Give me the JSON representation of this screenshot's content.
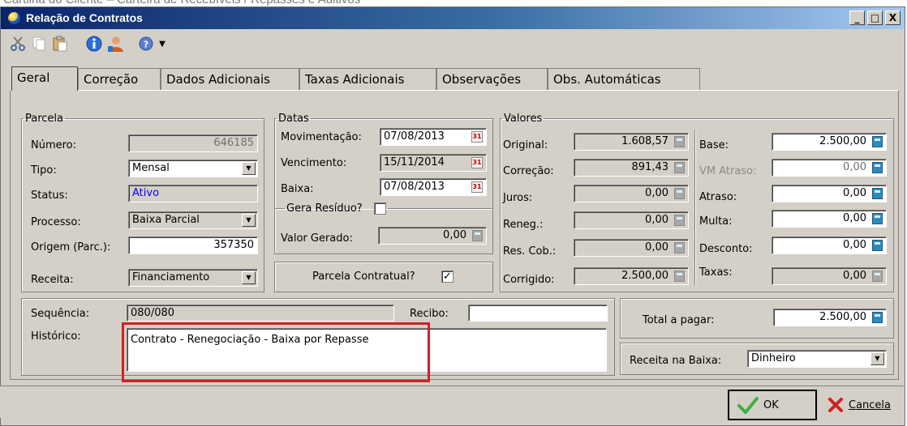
{
  "caption": "Cartilha do Cliente – Carteira de Recebíveis / Repasses e Aditivos",
  "window": {
    "title": "Relação de Contratos",
    "buttons": [
      "_",
      "□",
      "X"
    ]
  },
  "toolbar": {
    "icons": [
      "scissors-icon",
      "copy-icon",
      "paste-icon",
      "info-icon",
      "user-icon",
      "help-icon",
      "dropdown-arrow-icon"
    ]
  },
  "tabs": [
    "Geral",
    "Correção",
    "Dados Adicionais",
    "Taxas Adicionais",
    "Observações",
    "Obs. Automáticas"
  ],
  "parcela": {
    "legend": "Parcela",
    "numero_label": "Número:",
    "numero": "646185",
    "tipo_label": "Tipo:",
    "tipo": "Mensal",
    "status_label": "Status:",
    "status": "Ativo",
    "processo_label": "Processo:",
    "processo": "Baixa Parcial",
    "origem_label": "Origem (Parc.):",
    "origem": "357350",
    "receita_label": "Receita:",
    "receita": "Financiamento"
  },
  "datas": {
    "legend": "Datas",
    "movimentacao_label": "Movimentação:",
    "movimentacao": "07/08/2013",
    "vencimento_label": "Vencimento:",
    "vencimento": "15/11/2014",
    "baixa_label": "Baixa:",
    "baixa": "07/08/2013",
    "gera_residuo_label": "Gera Resíduo?",
    "gera_residuo": false,
    "valor_gerado_label": "Valor Gerado:",
    "valor_gerado": "0,00",
    "parcela_contratual_label": "Parcela Contratual?",
    "parcela_contratual": true,
    "cal_glyph": "31"
  },
  "valores": {
    "legend": "Valores",
    "original_label": "Original:",
    "original": "1.608,57",
    "correcao_label": "Correção:",
    "correcao": "891,43",
    "juros_label": "Juros:",
    "juros": "0,00",
    "reneg_label": "Reneg.:",
    "reneg": "0,00",
    "res_cob_label": "Res. Cob.:",
    "res_cob": "0,00",
    "corrigido_label": "Corrigido:",
    "corrigido": "2.500,00",
    "base_label": "Base:",
    "base": "2.500,00",
    "vm_atraso_label": "VM Atraso:",
    "vm_atraso": "0,00",
    "atraso_label": "Atraso:",
    "atraso": "0,00",
    "multa_label": "Multa:",
    "multa": "0,00",
    "desconto_label": "Desconto:",
    "desconto": "0,00",
    "taxas_label": "Taxas:",
    "taxas": "0,00"
  },
  "bottom": {
    "sequencia_label": "Sequência:",
    "sequencia": "080/080",
    "recibo_label": "Recibo:",
    "recibo": "",
    "historico_label": "Histórico:",
    "historico": "Contrato - Renegociação - Baixa por Repasse",
    "total_label": "Total a pagar:",
    "total": "2.500,00",
    "receita_baixa_label": "Receita na Baixa:",
    "receita_baixa": "Dinheiro"
  },
  "actions": {
    "ok": "OK",
    "cancel": "Cancela"
  },
  "colors": {
    "highlight": "#d32020",
    "status_text": "#0000ff",
    "ok_check": "#3cb043",
    "cancel_x": "#d02020"
  }
}
